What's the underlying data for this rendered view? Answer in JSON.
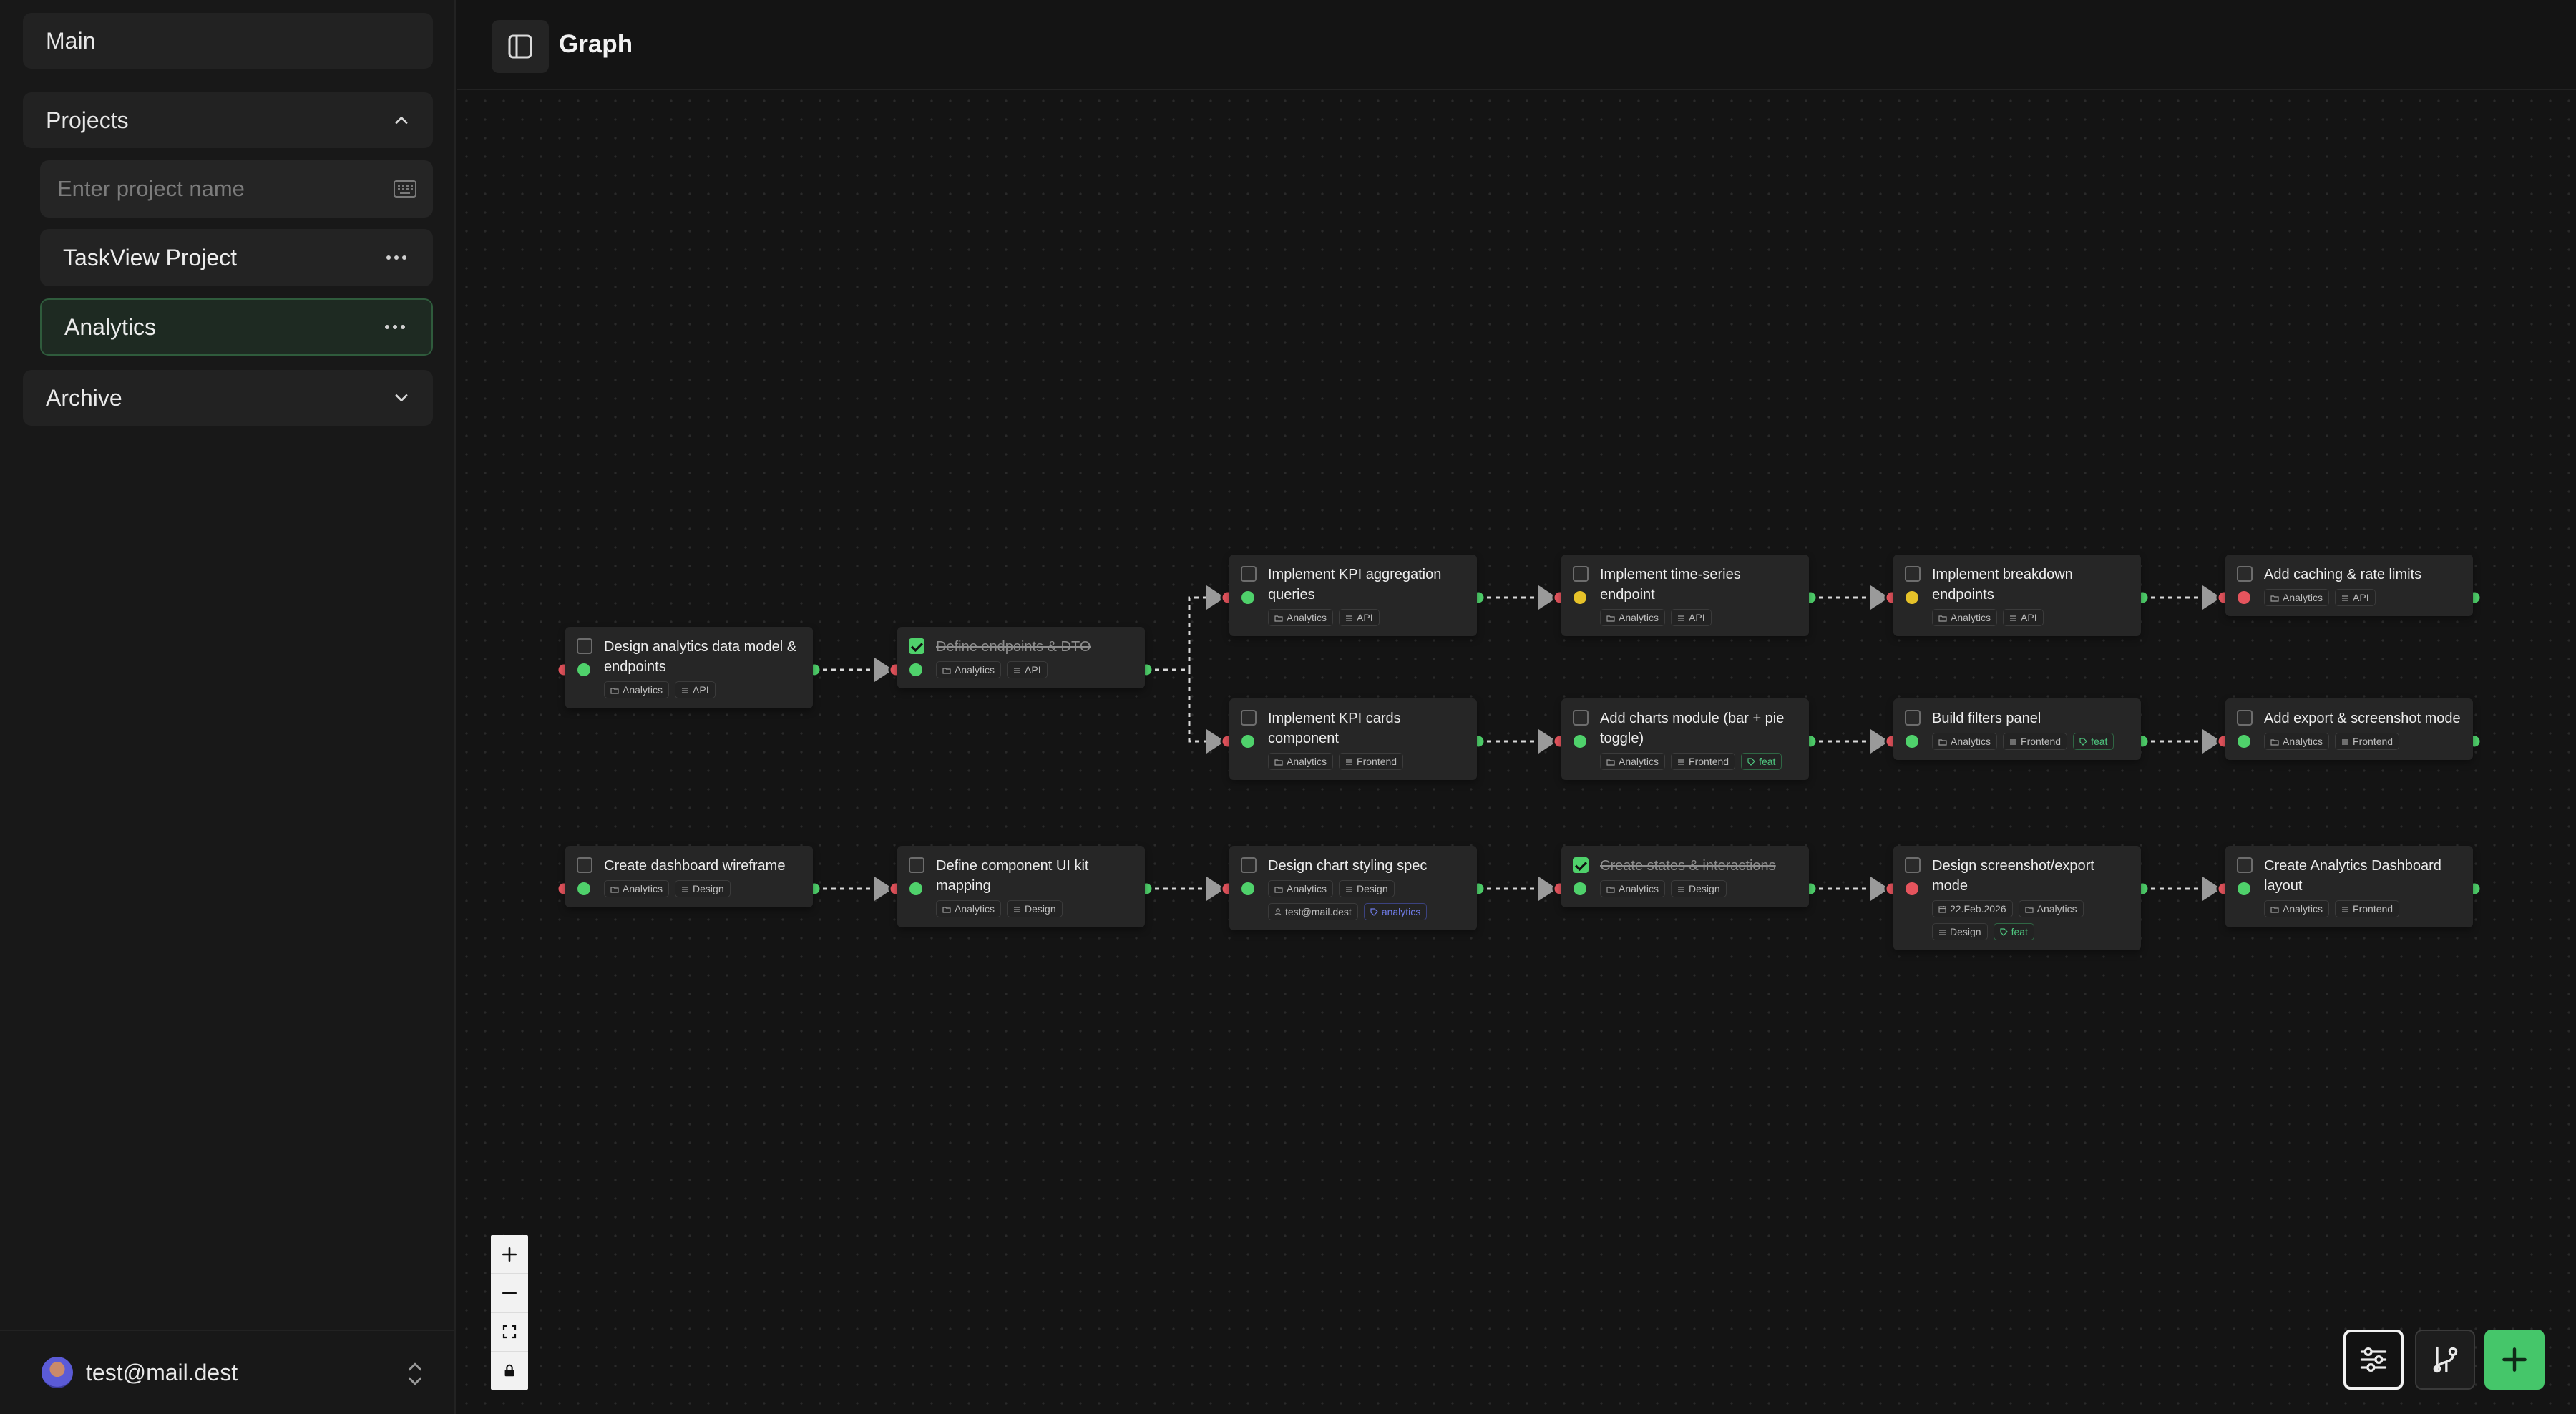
{
  "sidebar": {
    "main_label": "Main",
    "projects_label": "Projects",
    "project_input_placeholder": "Enter project name",
    "projects": [
      {
        "label": "TaskView Project",
        "selected": false
      },
      {
        "label": "Analytics",
        "selected": true
      }
    ],
    "archive_label": "Archive",
    "user_email": "test@mail.dest"
  },
  "header": {
    "title": "Graph"
  },
  "colors": {
    "accent_green": "#45c66a",
    "status_red": "#e5545d",
    "status_green": "#4fd16b",
    "status_yellow": "#e6c229",
    "node_bg": "#262626"
  },
  "icons": {
    "sidebar_toggle": "sidebar-panel-icon",
    "keyboard": "keyboard-icon",
    "more": "more-dots-icon",
    "chevron_up": "chevron-up-icon",
    "chevron_down": "chevron-down-icon",
    "zoom_in": "plus-icon",
    "zoom_out": "minus-icon",
    "fit": "fit-view-icon",
    "lock": "lock-icon",
    "filter": "sliders-icon",
    "branch": "git-branch-icon",
    "add": "plus-icon"
  },
  "nodes": [
    {
      "id": "n1",
      "title": "Design analytics data model & endpoints",
      "done": false,
      "status": "green",
      "tags": [
        {
          "kind": "folder",
          "text": "Analytics"
        },
        {
          "kind": "list",
          "text": "API"
        }
      ]
    },
    {
      "id": "n2",
      "title": "Define endpoints & DTO",
      "done": true,
      "status": "green",
      "tags": [
        {
          "kind": "folder",
          "text": "Analytics"
        },
        {
          "kind": "list",
          "text": "API"
        }
      ]
    },
    {
      "id": "n3",
      "title": "Implement KPI aggregation queries",
      "done": false,
      "status": "green",
      "tags": [
        {
          "kind": "folder",
          "text": "Analytics"
        },
        {
          "kind": "list",
          "text": "API"
        }
      ]
    },
    {
      "id": "n4",
      "title": "Implement time-series endpoint",
      "done": false,
      "status": "yellow",
      "tags": [
        {
          "kind": "folder",
          "text": "Analytics"
        },
        {
          "kind": "list",
          "text": "API"
        }
      ]
    },
    {
      "id": "n5",
      "title": "Implement breakdown endpoints",
      "done": false,
      "status": "yellow",
      "tags": [
        {
          "kind": "folder",
          "text": "Analytics"
        },
        {
          "kind": "list",
          "text": "API"
        }
      ]
    },
    {
      "id": "n6",
      "title": "Add caching & rate limits",
      "done": false,
      "status": "red",
      "tags": [
        {
          "kind": "folder",
          "text": "Analytics"
        },
        {
          "kind": "list",
          "text": "API"
        }
      ]
    },
    {
      "id": "n7",
      "title": "Implement KPI cards component",
      "done": false,
      "status": "green",
      "tags": [
        {
          "kind": "folder",
          "text": "Analytics"
        },
        {
          "kind": "list",
          "text": "Frontend"
        }
      ]
    },
    {
      "id": "n8",
      "title": "Add charts module (bar + pie toggle)",
      "done": false,
      "status": "green",
      "tags": [
        {
          "kind": "folder",
          "text": "Analytics"
        },
        {
          "kind": "list",
          "text": "Frontend"
        },
        {
          "kind": "label-green",
          "text": "feat"
        }
      ]
    },
    {
      "id": "n9",
      "title": "Build filters panel",
      "done": false,
      "status": "green",
      "tags": [
        {
          "kind": "folder",
          "text": "Analytics"
        },
        {
          "kind": "list",
          "text": "Frontend"
        },
        {
          "kind": "label-green",
          "text": "feat"
        }
      ]
    },
    {
      "id": "n10",
      "title": "Add export & screenshot mode",
      "done": false,
      "status": "green",
      "tags": [
        {
          "kind": "folder",
          "text": "Analytics"
        },
        {
          "kind": "list",
          "text": "Frontend"
        }
      ]
    },
    {
      "id": "n11",
      "title": "Create dashboard wireframe",
      "done": false,
      "status": "green",
      "tags": [
        {
          "kind": "folder",
          "text": "Analytics"
        },
        {
          "kind": "list",
          "text": "Design"
        }
      ]
    },
    {
      "id": "n12",
      "title": "Define component UI kit mapping",
      "done": false,
      "status": "green",
      "tags": [
        {
          "kind": "folder",
          "text": "Analytics"
        },
        {
          "kind": "list",
          "text": "Design"
        }
      ]
    },
    {
      "id": "n13",
      "title": "Design chart styling spec",
      "done": false,
      "status": "green",
      "tags": [
        {
          "kind": "folder",
          "text": "Analytics"
        },
        {
          "kind": "list",
          "text": "Design"
        },
        {
          "kind": "user",
          "text": "test@mail.dest"
        },
        {
          "kind": "label-blue",
          "text": "analytics"
        }
      ]
    },
    {
      "id": "n14",
      "title": "Create states & interactions",
      "done": true,
      "status": "green",
      "tags": [
        {
          "kind": "folder",
          "text": "Analytics"
        },
        {
          "kind": "list",
          "text": "Design"
        }
      ]
    },
    {
      "id": "n15",
      "title": "Design screenshot/export mode",
      "done": false,
      "status": "red",
      "tags": [
        {
          "kind": "date",
          "text": "22.Feb.2026"
        },
        {
          "kind": "folder",
          "text": "Analytics"
        },
        {
          "kind": "list",
          "text": "Design"
        },
        {
          "kind": "label-green",
          "text": "feat"
        }
      ]
    },
    {
      "id": "n16",
      "title": "Create Analytics Dashboard layout",
      "done": false,
      "status": "green",
      "tags": [
        {
          "kind": "folder",
          "text": "Analytics"
        },
        {
          "kind": "list",
          "text": "Frontend"
        }
      ]
    }
  ],
  "edges": [
    [
      "n1",
      "n2"
    ],
    [
      "n2",
      "n3"
    ],
    [
      "n2",
      "n7"
    ],
    [
      "n3",
      "n4"
    ],
    [
      "n4",
      "n5"
    ],
    [
      "n5",
      "n6"
    ],
    [
      "n7",
      "n8"
    ],
    [
      "n8",
      "n9"
    ],
    [
      "n9",
      "n10"
    ],
    [
      "n11",
      "n12"
    ],
    [
      "n12",
      "n13"
    ],
    [
      "n13",
      "n14"
    ],
    [
      "n14",
      "n15"
    ],
    [
      "n15",
      "n16"
    ]
  ]
}
